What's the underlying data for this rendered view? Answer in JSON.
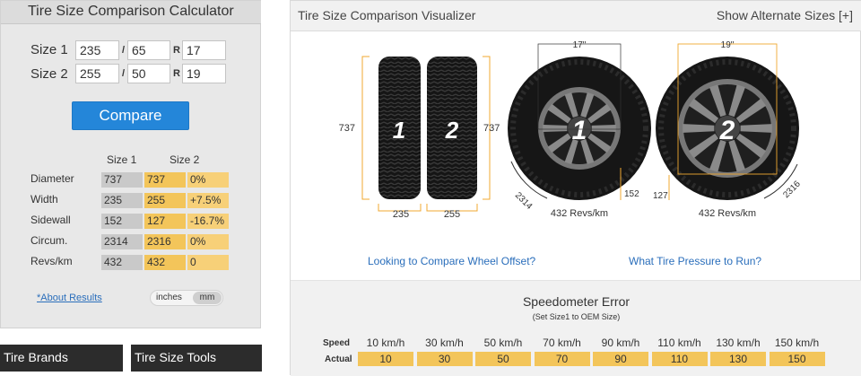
{
  "calculator": {
    "title": "Tire Size Comparison Calculator",
    "size1": {
      "label": "Size 1",
      "width": "235",
      "ratio": "65",
      "rim": "17"
    },
    "size2": {
      "label": "Size 2",
      "width": "255",
      "ratio": "50",
      "rim": "19"
    },
    "slash": "/",
    "r_label": "R",
    "compare_label": "Compare",
    "columns": [
      "Size 1",
      "Size 2"
    ],
    "rows": [
      {
        "label": "Diameter",
        "size1": "737",
        "size2": "737",
        "diff": "0%"
      },
      {
        "label": "Width",
        "size1": "235",
        "size2": "255",
        "diff": "+7.5%"
      },
      {
        "label": "Sidewall",
        "size1": "152",
        "size2": "127",
        "diff": "-16.7%"
      },
      {
        "label": "Circum.",
        "size1": "2314",
        "size2": "2316",
        "diff": "0%"
      },
      {
        "label": "Revs/km",
        "size1": "432",
        "size2": "432",
        "diff": "0"
      }
    ],
    "about_link": "*About Results",
    "units": {
      "inches": "inches",
      "mm": "mm",
      "selected": "mm"
    }
  },
  "nav": {
    "tire_brands": "Tire Brands",
    "tire_size_tools": "Tire Size Tools"
  },
  "visualizer": {
    "title": "Tire Size Comparison Visualizer",
    "alternate_link": "Show Alternate Sizes [+]",
    "side_view": {
      "tire1_number": "1",
      "tire2_number": "2",
      "height_left": "737",
      "height_right": "737",
      "width1": "235",
      "width2": "255"
    },
    "wheel1": {
      "number": "1",
      "rim": "17\"",
      "circumference": "2314",
      "sidewall": "152",
      "revs": "432 Revs/km"
    },
    "wheel2": {
      "number": "2",
      "rim": "19\"",
      "circumference": "2316",
      "sidewall": "127",
      "revs": "432 Revs/km"
    },
    "offset_link": "Looking to Compare Wheel Offset?",
    "pressure_link": "What Tire Pressure to Run?"
  },
  "speedometer": {
    "title": "Speedometer Error",
    "subtitle": "(Set Size1 to OEM Size)",
    "speed_label": "Speed",
    "actual_label": "Actual",
    "speeds": [
      "10 km/h",
      "30 km/h",
      "50 km/h",
      "70 km/h",
      "90 km/h",
      "110 km/h",
      "130 km/h",
      "150 km/h"
    ],
    "actuals": [
      "10",
      "30",
      "50",
      "70",
      "90",
      "110",
      "130",
      "150"
    ]
  },
  "colors": {
    "accent": "#2486d9",
    "highlight": "#f3c55a",
    "guide": "#f0a830"
  }
}
